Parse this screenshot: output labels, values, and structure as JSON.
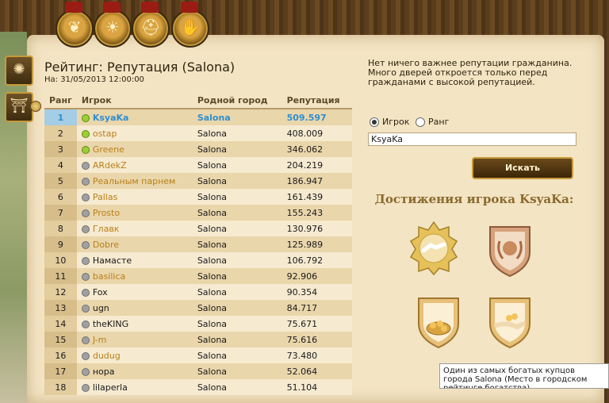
{
  "header": {
    "title": "Рейтинг: Репутация (Salona)",
    "date": "На: 31/05/2013 12:00:00"
  },
  "table": {
    "columns": [
      "Ранг",
      "Игрок",
      "Родной город",
      "Репутация"
    ],
    "rows": [
      {
        "rank": "1",
        "player": "KsyaKa",
        "city": "Salona",
        "rep": "509.597",
        "online": true,
        "selected": true,
        "link": true
      },
      {
        "rank": "2",
        "player": "ostap",
        "city": "Salona",
        "rep": "408.009",
        "online": true,
        "link": true
      },
      {
        "rank": "3",
        "player": "Greene",
        "city": "Salona",
        "rep": "346.062",
        "online": true,
        "link": true
      },
      {
        "rank": "4",
        "player": "ARdekZ",
        "city": "Salona",
        "rep": "204.219",
        "online": false,
        "link": true
      },
      {
        "rank": "5",
        "player": "Реальным парнем",
        "city": "Salona",
        "rep": "186.947",
        "online": false,
        "link": true
      },
      {
        "rank": "6",
        "player": "Pallas",
        "city": "Salona",
        "rep": "161.439",
        "online": false,
        "link": true
      },
      {
        "rank": "7",
        "player": "Prosto",
        "city": "Salona",
        "rep": "155.243",
        "online": false,
        "link": true
      },
      {
        "rank": "8",
        "player": "Главк",
        "city": "Salona",
        "rep": "130.976",
        "online": false,
        "link": true
      },
      {
        "rank": "9",
        "player": "Dobre",
        "city": "Salona",
        "rep": "125.989",
        "online": false,
        "link": true
      },
      {
        "rank": "10",
        "player": "Намасте",
        "city": "Salona",
        "rep": "106.792",
        "online": false,
        "link": false
      },
      {
        "rank": "11",
        "player": "basilica",
        "city": "Salona",
        "rep": "92.906",
        "online": false,
        "link": true
      },
      {
        "rank": "12",
        "player": "Fox",
        "city": "Salona",
        "rep": "90.354",
        "online": false,
        "link": false
      },
      {
        "rank": "13",
        "player": "ugn",
        "city": "Salona",
        "rep": "84.717",
        "online": false,
        "link": false
      },
      {
        "rank": "14",
        "player": "theKING",
        "city": "Salona",
        "rep": "75.671",
        "online": false,
        "link": false
      },
      {
        "rank": "15",
        "player": "J-m",
        "city": "Salona",
        "rep": "75.616",
        "online": false,
        "link": true
      },
      {
        "rank": "16",
        "player": "dudug",
        "city": "Salona",
        "rep": "73.480",
        "online": false,
        "link": true
      },
      {
        "rank": "17",
        "player": "нора",
        "city": "Salona",
        "rep": "52.064",
        "online": false,
        "link": false
      },
      {
        "rank": "18",
        "player": "lilaperla",
        "city": "Salona",
        "rep": "51.104",
        "online": false,
        "link": false
      }
    ]
  },
  "panel": {
    "description": "Нет ничего важнее репутации гражданина. Много дверей откроется только перед гражданами с высокой репутацией.",
    "radio_player": "Игрок",
    "radio_rank": "Ранг",
    "search_value": "KsyaKa",
    "search_button": "Искать",
    "achievements_title": "Достижения игрока KsyaKa:"
  },
  "tooltip": "Один из самых богатых купцов города Salona (Место в городском рейтинге богатства)",
  "tabs": [
    "laurel-icon",
    "sun-icon",
    "helmet-icon",
    "handshake-icon"
  ],
  "sidebar": [
    "compass-icon",
    "temple-icon"
  ],
  "colors": {
    "accent": "#2f8fd0",
    "gold": "#c89b3a",
    "link": "#b8801a",
    "paper": "#f3e4c3"
  }
}
